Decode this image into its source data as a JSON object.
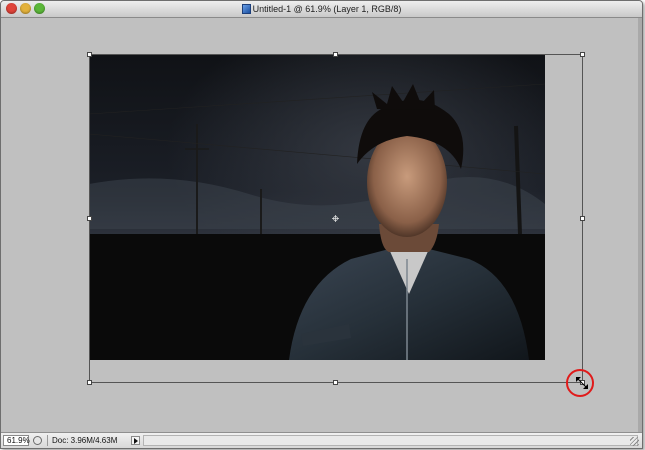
{
  "window": {
    "title": "Untitled-1 @ 61.9% (Layer 1, RGB/8)",
    "traffic_lights": {
      "close_color": "#e0443a",
      "minimize_color": "#e3b23c",
      "zoom_color": "#5cb83a"
    }
  },
  "document": {
    "icon": "photoshop-document-icon",
    "canvas_background_color": "#c0c0c0"
  },
  "transform": {
    "handle_icon": "transform-handle-icon",
    "center_icon": "reference-point-icon",
    "highlight_color": "#e01a1a"
  },
  "statusbar": {
    "zoom": "61.9%",
    "doc_size": "Doc: 3.96M/4.63M",
    "menu_icon": "status-menu-arrow-icon"
  }
}
